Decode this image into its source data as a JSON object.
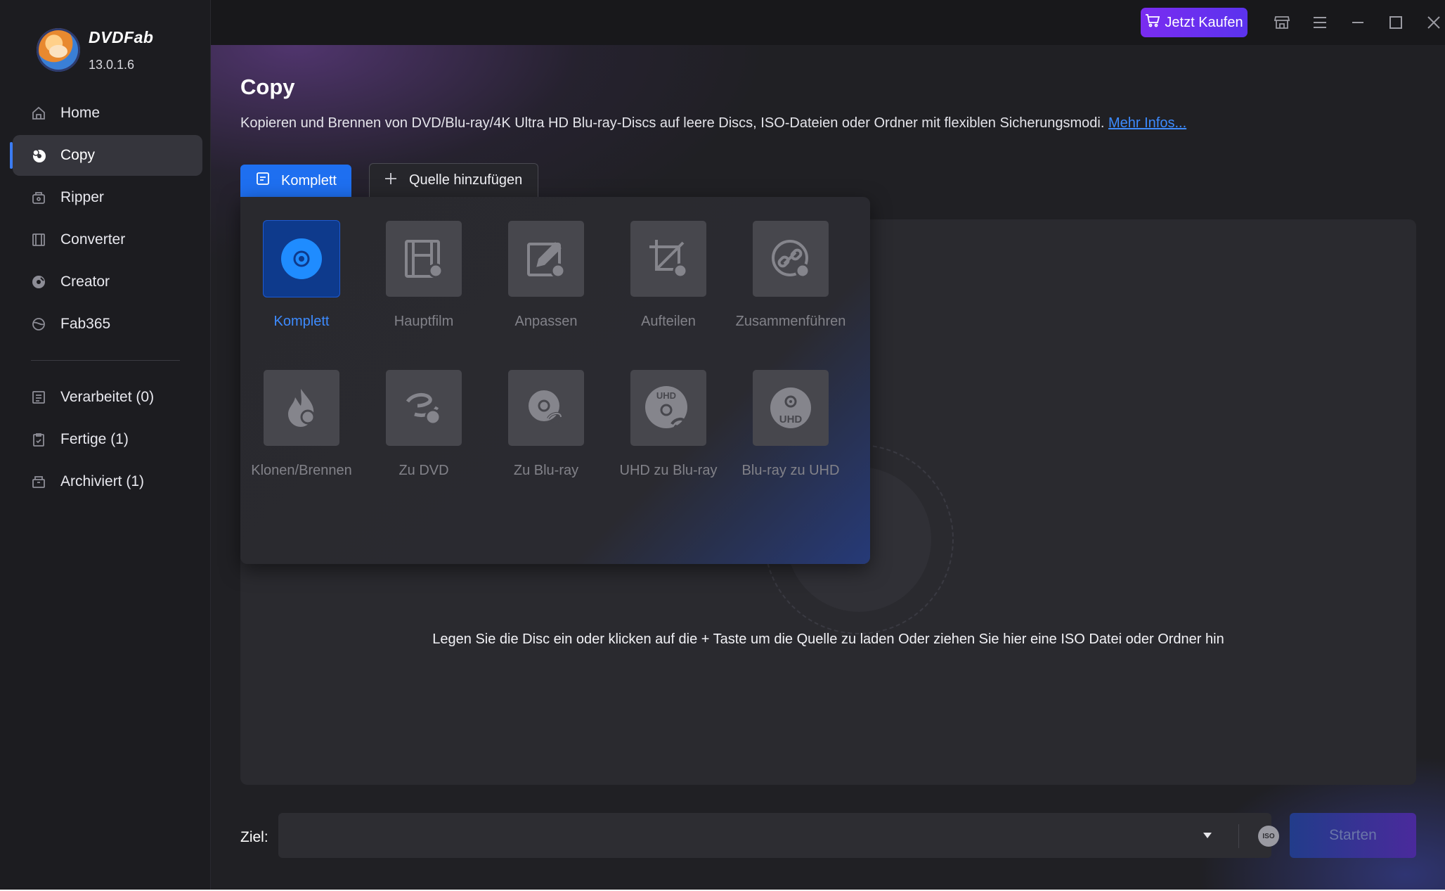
{
  "app": {
    "brand": "DVDFab",
    "version": "13.0.1.6"
  },
  "topbar": {
    "buy_label": "Jetzt Kaufen",
    "icons": [
      "cart-icon",
      "store-icon",
      "menu-icon",
      "minimize-icon",
      "maximize-icon",
      "close-icon"
    ]
  },
  "sidebar": {
    "items": [
      {
        "label": "Home",
        "icon": "home-icon"
      },
      {
        "label": "Copy",
        "icon": "copy-disc-icon",
        "active": true
      },
      {
        "label": "Ripper",
        "icon": "ripper-icon"
      },
      {
        "label": "Converter",
        "icon": "converter-icon"
      },
      {
        "label": "Creator",
        "icon": "creator-icon"
      },
      {
        "label": "Fab365",
        "icon": "fab365-icon"
      }
    ],
    "queue": [
      {
        "label": "Verarbeitet (0)",
        "icon": "processing-list-icon"
      },
      {
        "label": "Fertige (1)",
        "icon": "finished-clipboard-icon"
      },
      {
        "label": "Archiviert (1)",
        "icon": "archive-box-icon"
      }
    ]
  },
  "main": {
    "title": "Copy",
    "description": "Kopieren und Brennen von DVD/Blu-ray/4K Ultra HD Blu-ray-Discs auf leere Discs, ISO-Dateien oder Ordner mit flexiblen Sicherungsmodi.",
    "more_link": "Mehr Infos...",
    "mode_button": "Komplett",
    "add_source_button": "Quelle hinzufügen",
    "drop_message": "Legen Sie die Disc ein oder klicken auf die + Taste um die Quelle zu laden Oder ziehen Sie hier eine ISO Datei oder Ordner hin"
  },
  "modes": [
    {
      "label": "Komplett",
      "icon": "full-disc-icon",
      "selected": true
    },
    {
      "label": "Hauptfilm",
      "icon": "film-strip-icon"
    },
    {
      "label": "Anpassen",
      "icon": "customize-edit-icon"
    },
    {
      "label": "Aufteilen",
      "icon": "split-crop-icon"
    },
    {
      "label": "Zusammenführen",
      "icon": "merge-link-icon"
    },
    {
      "label": "Klonen/Brennen",
      "icon": "burn-flame-icon"
    },
    {
      "label": "Zu DVD",
      "icon": "bluray-to-dvd-icon"
    },
    {
      "label": "Zu Blu-ray",
      "icon": "to-bluray-icon"
    },
    {
      "label": "UHD zu Blu-ray",
      "icon": "uhd-to-bluray-icon"
    },
    {
      "label": "Blu-ray zu UHD",
      "icon": "bluray-to-uhd-icon"
    }
  ],
  "bottom": {
    "target_label": "Ziel:",
    "target_value": "",
    "iso_label": "ISO",
    "start_label": "Starten"
  },
  "colors": {
    "accent": "#1e6ff0",
    "link": "#3d8bff",
    "buy": "#7a2cf0",
    "background": "#202024",
    "sidebar": "#1c1c20"
  }
}
